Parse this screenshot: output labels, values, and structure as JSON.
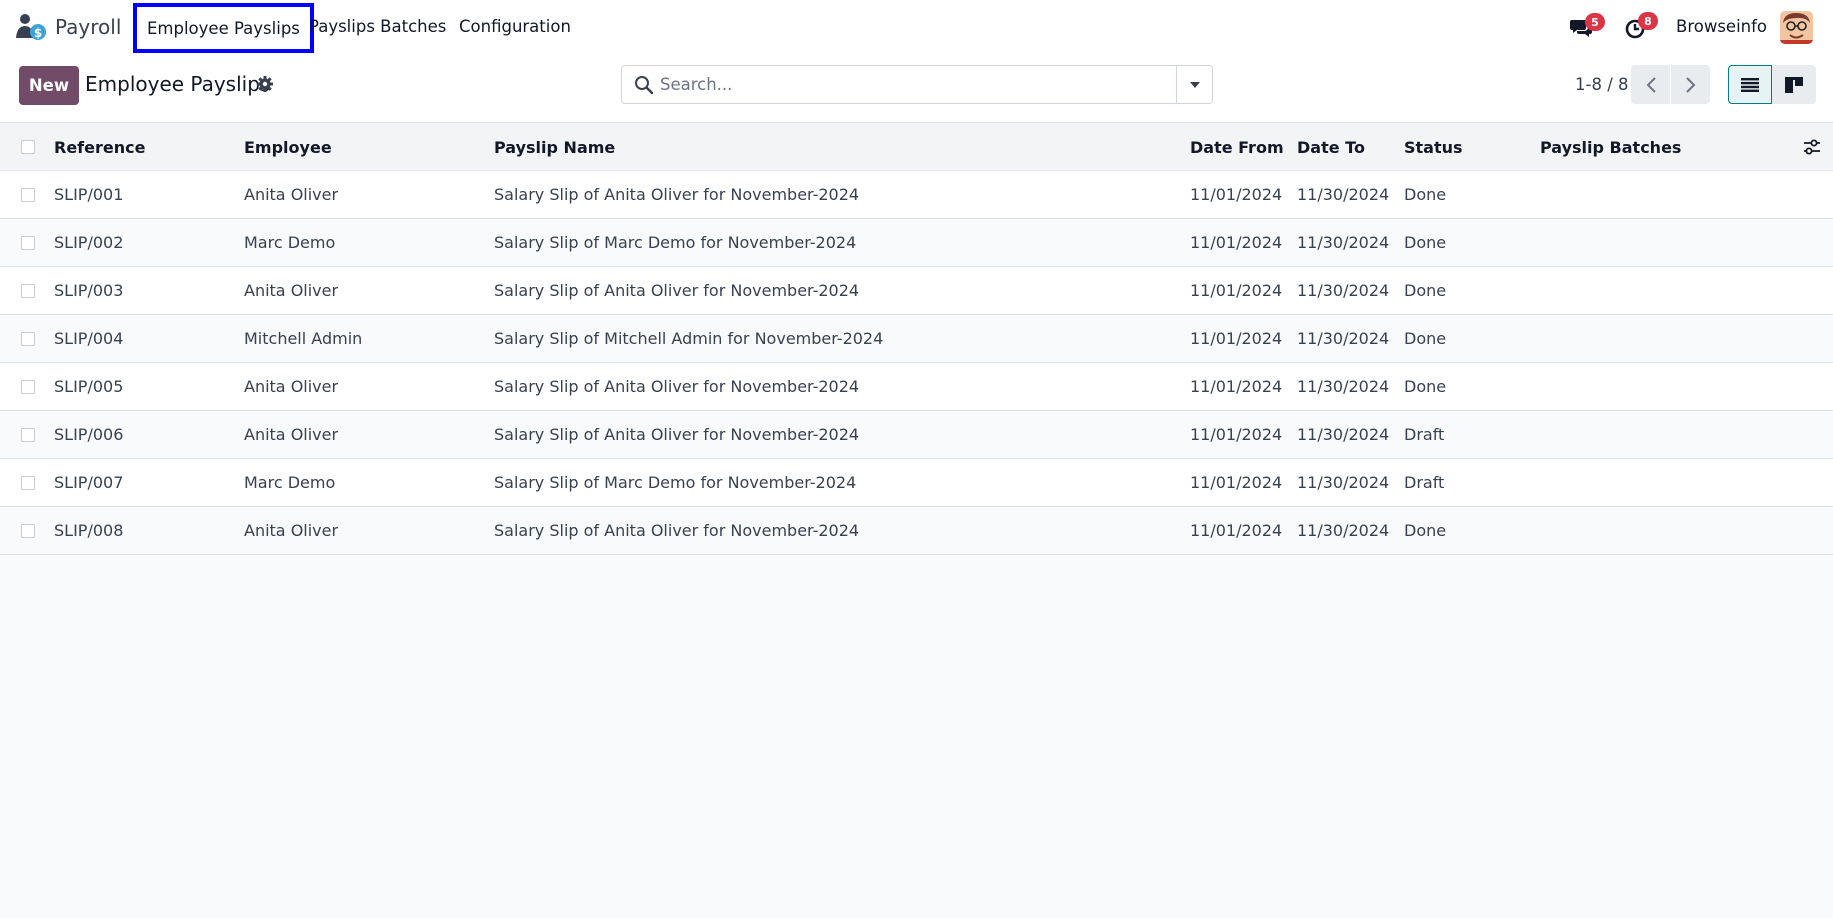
{
  "navbar": {
    "app_name": "Payroll",
    "menus": [
      {
        "label": "Employee Payslips"
      },
      {
        "label": "Payslips Batches"
      },
      {
        "label": "Configuration"
      }
    ],
    "messages_count": "5",
    "activities_count": "8",
    "user_name": "Browseinfo",
    "highlight_color": "#0000ff"
  },
  "control": {
    "new_label": "New",
    "title": "Employee Payslips",
    "search_placeholder": "Search...",
    "pager_value": "1-8 / 8",
    "accent_color": "#714b67"
  },
  "table": {
    "headers": {
      "reference": "Reference",
      "employee": "Employee",
      "payslip_name": "Payslip Name",
      "date_from": "Date From",
      "date_to": "Date To",
      "status": "Status",
      "payslip_batches": "Payslip Batches"
    },
    "rows": [
      {
        "reference": "SLIP/001",
        "employee": "Anita Oliver",
        "name": "Salary Slip of Anita Oliver for November-2024",
        "date_from": "11/01/2024",
        "date_to": "11/30/2024",
        "status": "Done",
        "batch": ""
      },
      {
        "reference": "SLIP/002",
        "employee": "Marc Demo",
        "name": "Salary Slip of Marc Demo for November-2024",
        "date_from": "11/01/2024",
        "date_to": "11/30/2024",
        "status": "Done",
        "batch": ""
      },
      {
        "reference": "SLIP/003",
        "employee": "Anita Oliver",
        "name": "Salary Slip of Anita Oliver for November-2024",
        "date_from": "11/01/2024",
        "date_to": "11/30/2024",
        "status": "Done",
        "batch": ""
      },
      {
        "reference": "SLIP/004",
        "employee": "Mitchell Admin",
        "name": "Salary Slip of Mitchell Admin for November-2024",
        "date_from": "11/01/2024",
        "date_to": "11/30/2024",
        "status": "Done",
        "batch": ""
      },
      {
        "reference": "SLIP/005",
        "employee": "Anita Oliver",
        "name": "Salary Slip of Anita Oliver for November-2024",
        "date_from": "11/01/2024",
        "date_to": "11/30/2024",
        "status": "Done",
        "batch": ""
      },
      {
        "reference": "SLIP/006",
        "employee": "Anita Oliver",
        "name": "Salary Slip of Anita Oliver for November-2024",
        "date_from": "11/01/2024",
        "date_to": "11/30/2024",
        "status": "Draft",
        "batch": ""
      },
      {
        "reference": "SLIP/007",
        "employee": "Marc Demo",
        "name": "Salary Slip of Marc Demo for November-2024",
        "date_from": "11/01/2024",
        "date_to": "11/30/2024",
        "status": "Draft",
        "batch": ""
      },
      {
        "reference": "SLIP/008",
        "employee": "Anita Oliver",
        "name": "Salary Slip of Anita Oliver for November-2024",
        "date_from": "11/01/2024",
        "date_to": "11/30/2024",
        "status": "Done",
        "batch": ""
      }
    ]
  },
  "icons": {
    "app_logo": "payroll-logo-icon",
    "messages": "chat-bubbles-icon",
    "activities": "clock-icon",
    "settings": "gear-icon",
    "search": "search-icon",
    "dropdown": "caret-down-icon",
    "prev": "chevron-left-icon",
    "next": "chevron-right-icon",
    "list_view": "list-view-icon",
    "kanban_view": "kanban-view-icon",
    "column_options": "sliders-icon"
  }
}
